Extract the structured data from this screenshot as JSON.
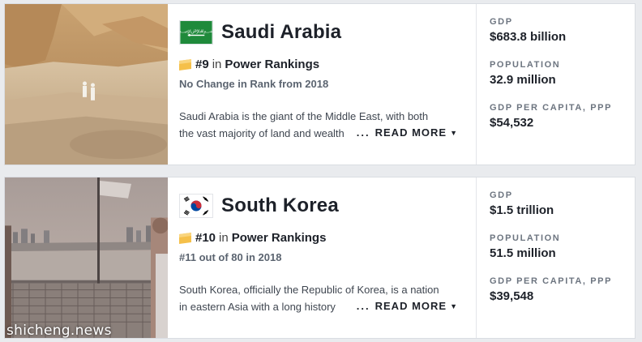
{
  "cards": [
    {
      "country": "Saudi Arabia",
      "flag_icon": "saudi-arabia-flag-icon",
      "rank": "#9",
      "rank_in": "in",
      "rank_link": "Power Rankings",
      "rank_change": "No Change in Rank from 2018",
      "desc_line1": "Saudi Arabia is the giant of the Middle East, with both",
      "desc_line2": "the vast majority of land and wealth",
      "dots": "...",
      "read_more": "READ MORE",
      "stats": [
        {
          "label": "GDP",
          "value": "$683.8 billion"
        },
        {
          "label": "POPULATION",
          "value": "32.9 million"
        },
        {
          "label": "GDP PER CAPITA, PPP",
          "value": "$54,532"
        }
      ]
    },
    {
      "country": "South Korea",
      "flag_icon": "south-korea-flag-icon",
      "rank": "#10",
      "rank_in": "in",
      "rank_link": "Power Rankings",
      "rank_change": "#11 out of 80 in 2018",
      "desc_line1": "South Korea, officially the Republic of Korea, is a nation",
      "desc_line2": "in eastern Asia with a long history",
      "dots": "...",
      "read_more": "READ MORE",
      "stats": [
        {
          "label": "GDP",
          "value": "$1.5 trillion"
        },
        {
          "label": "POPULATION",
          "value": "51.5 million"
        },
        {
          "label": "GDP PER CAPITA, PPP",
          "value": "$39,548"
        }
      ]
    }
  ],
  "watermark": "shicheng.news",
  "colors": {
    "ribbon": "#f5c04a",
    "saudi_green": "#1f8a3b",
    "korea_red": "#cd2e3a",
    "korea_blue": "#0047a0"
  }
}
